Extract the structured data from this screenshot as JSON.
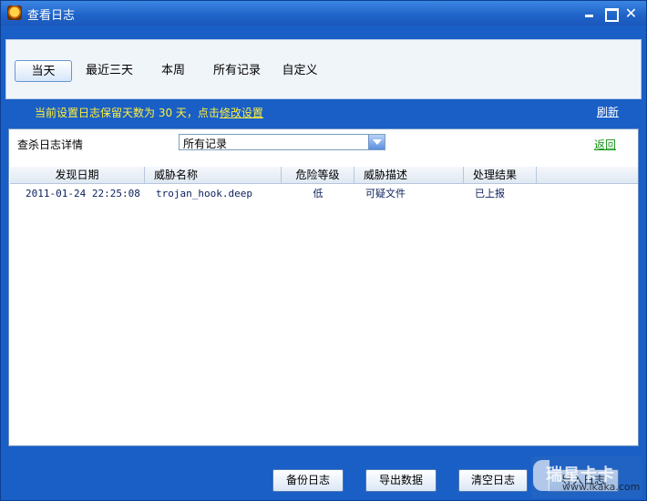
{
  "window": {
    "title": "查看日志"
  },
  "tabs": [
    {
      "label": "当天",
      "active": true
    },
    {
      "label": "最近三天",
      "active": false
    },
    {
      "label": "本周",
      "active": false
    },
    {
      "label": "所有记录",
      "active": false
    },
    {
      "label": "自定义",
      "active": false
    }
  ],
  "info": {
    "prefix": "当前设置日志保留天数为 30 天，点击",
    "link": "修改设置",
    "refresh": "刷新"
  },
  "filter": {
    "label": "查杀日志详情",
    "selected": "所有记录",
    "back": "返回"
  },
  "table": {
    "columns": [
      "发现日期",
      "威胁名称",
      "危险等级",
      "威胁描述",
      "处理结果"
    ],
    "rows": [
      [
        "2011-01-24 22:25:08",
        "trojan_hook.deep",
        "低",
        "可疑文件",
        "已上报"
      ]
    ]
  },
  "buttons": [
    "备份日志",
    "导出数据",
    "清空日志",
    "导入日志"
  ],
  "watermark": {
    "title": "瑞星卡卡",
    "url": "www.ikaka.com"
  },
  "colors": {
    "window_blue": "#1a5fc6",
    "info_yellow": "#ffef3b",
    "link_green": "#149514"
  }
}
